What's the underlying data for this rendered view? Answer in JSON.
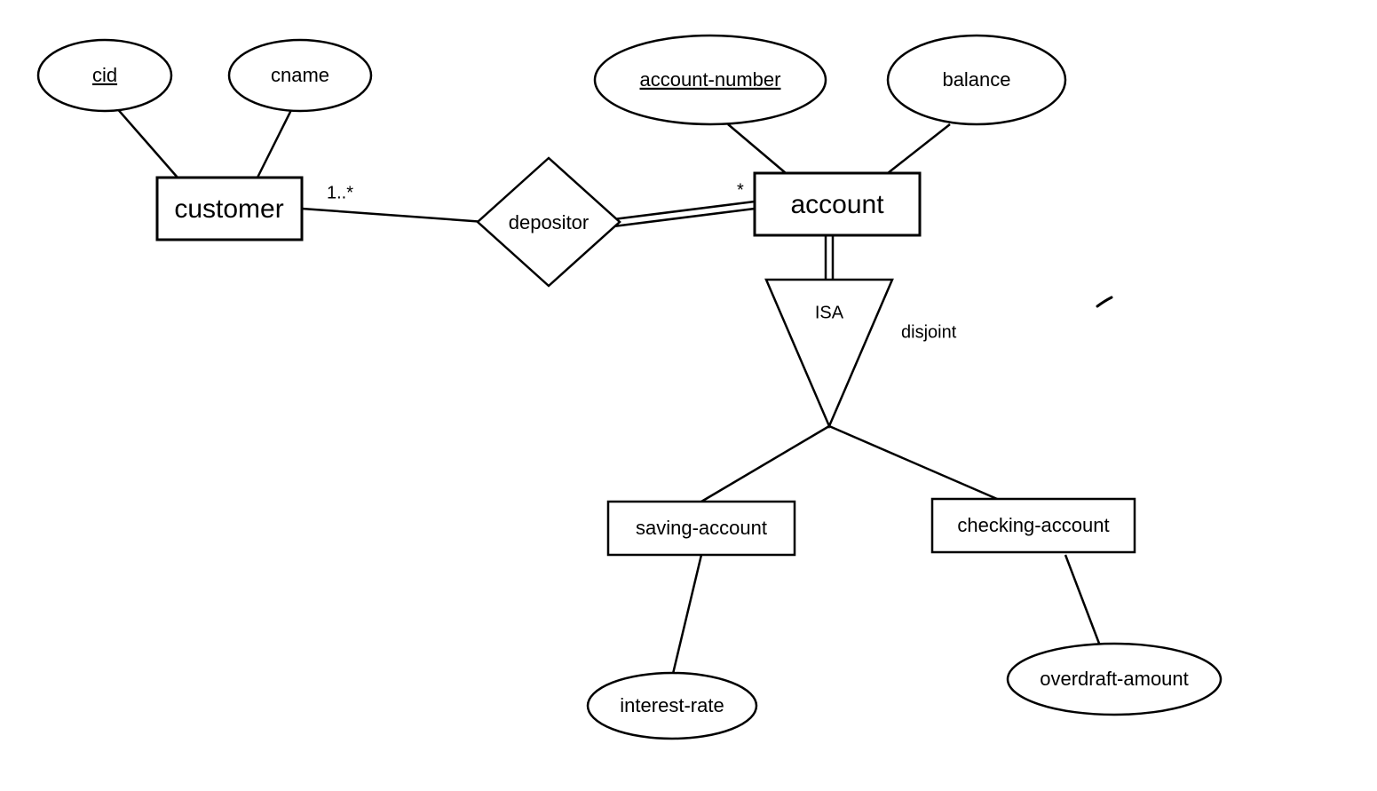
{
  "entities": {
    "customer": {
      "label": "customer"
    },
    "account": {
      "label": "account"
    },
    "saving_account": {
      "label": "saving-account"
    },
    "checking_account": {
      "label": "checking-account"
    }
  },
  "relationships": {
    "depositor": {
      "label": "depositor"
    }
  },
  "attributes": {
    "cid": {
      "label": "cid",
      "key": true
    },
    "cname": {
      "label": "cname",
      "key": false
    },
    "account_number": {
      "label": "account-number",
      "key": true
    },
    "balance": {
      "label": "balance",
      "key": false
    },
    "interest_rate": {
      "label": "interest-rate",
      "key": false
    },
    "overdraft_amount": {
      "label": "overdraft-amount",
      "key": false
    }
  },
  "inheritance": {
    "isa": {
      "label": "ISA",
      "constraint": "disjoint"
    }
  },
  "cardinalities": {
    "customer_to_depositor": "1..*",
    "depositor_to_account": "*"
  }
}
